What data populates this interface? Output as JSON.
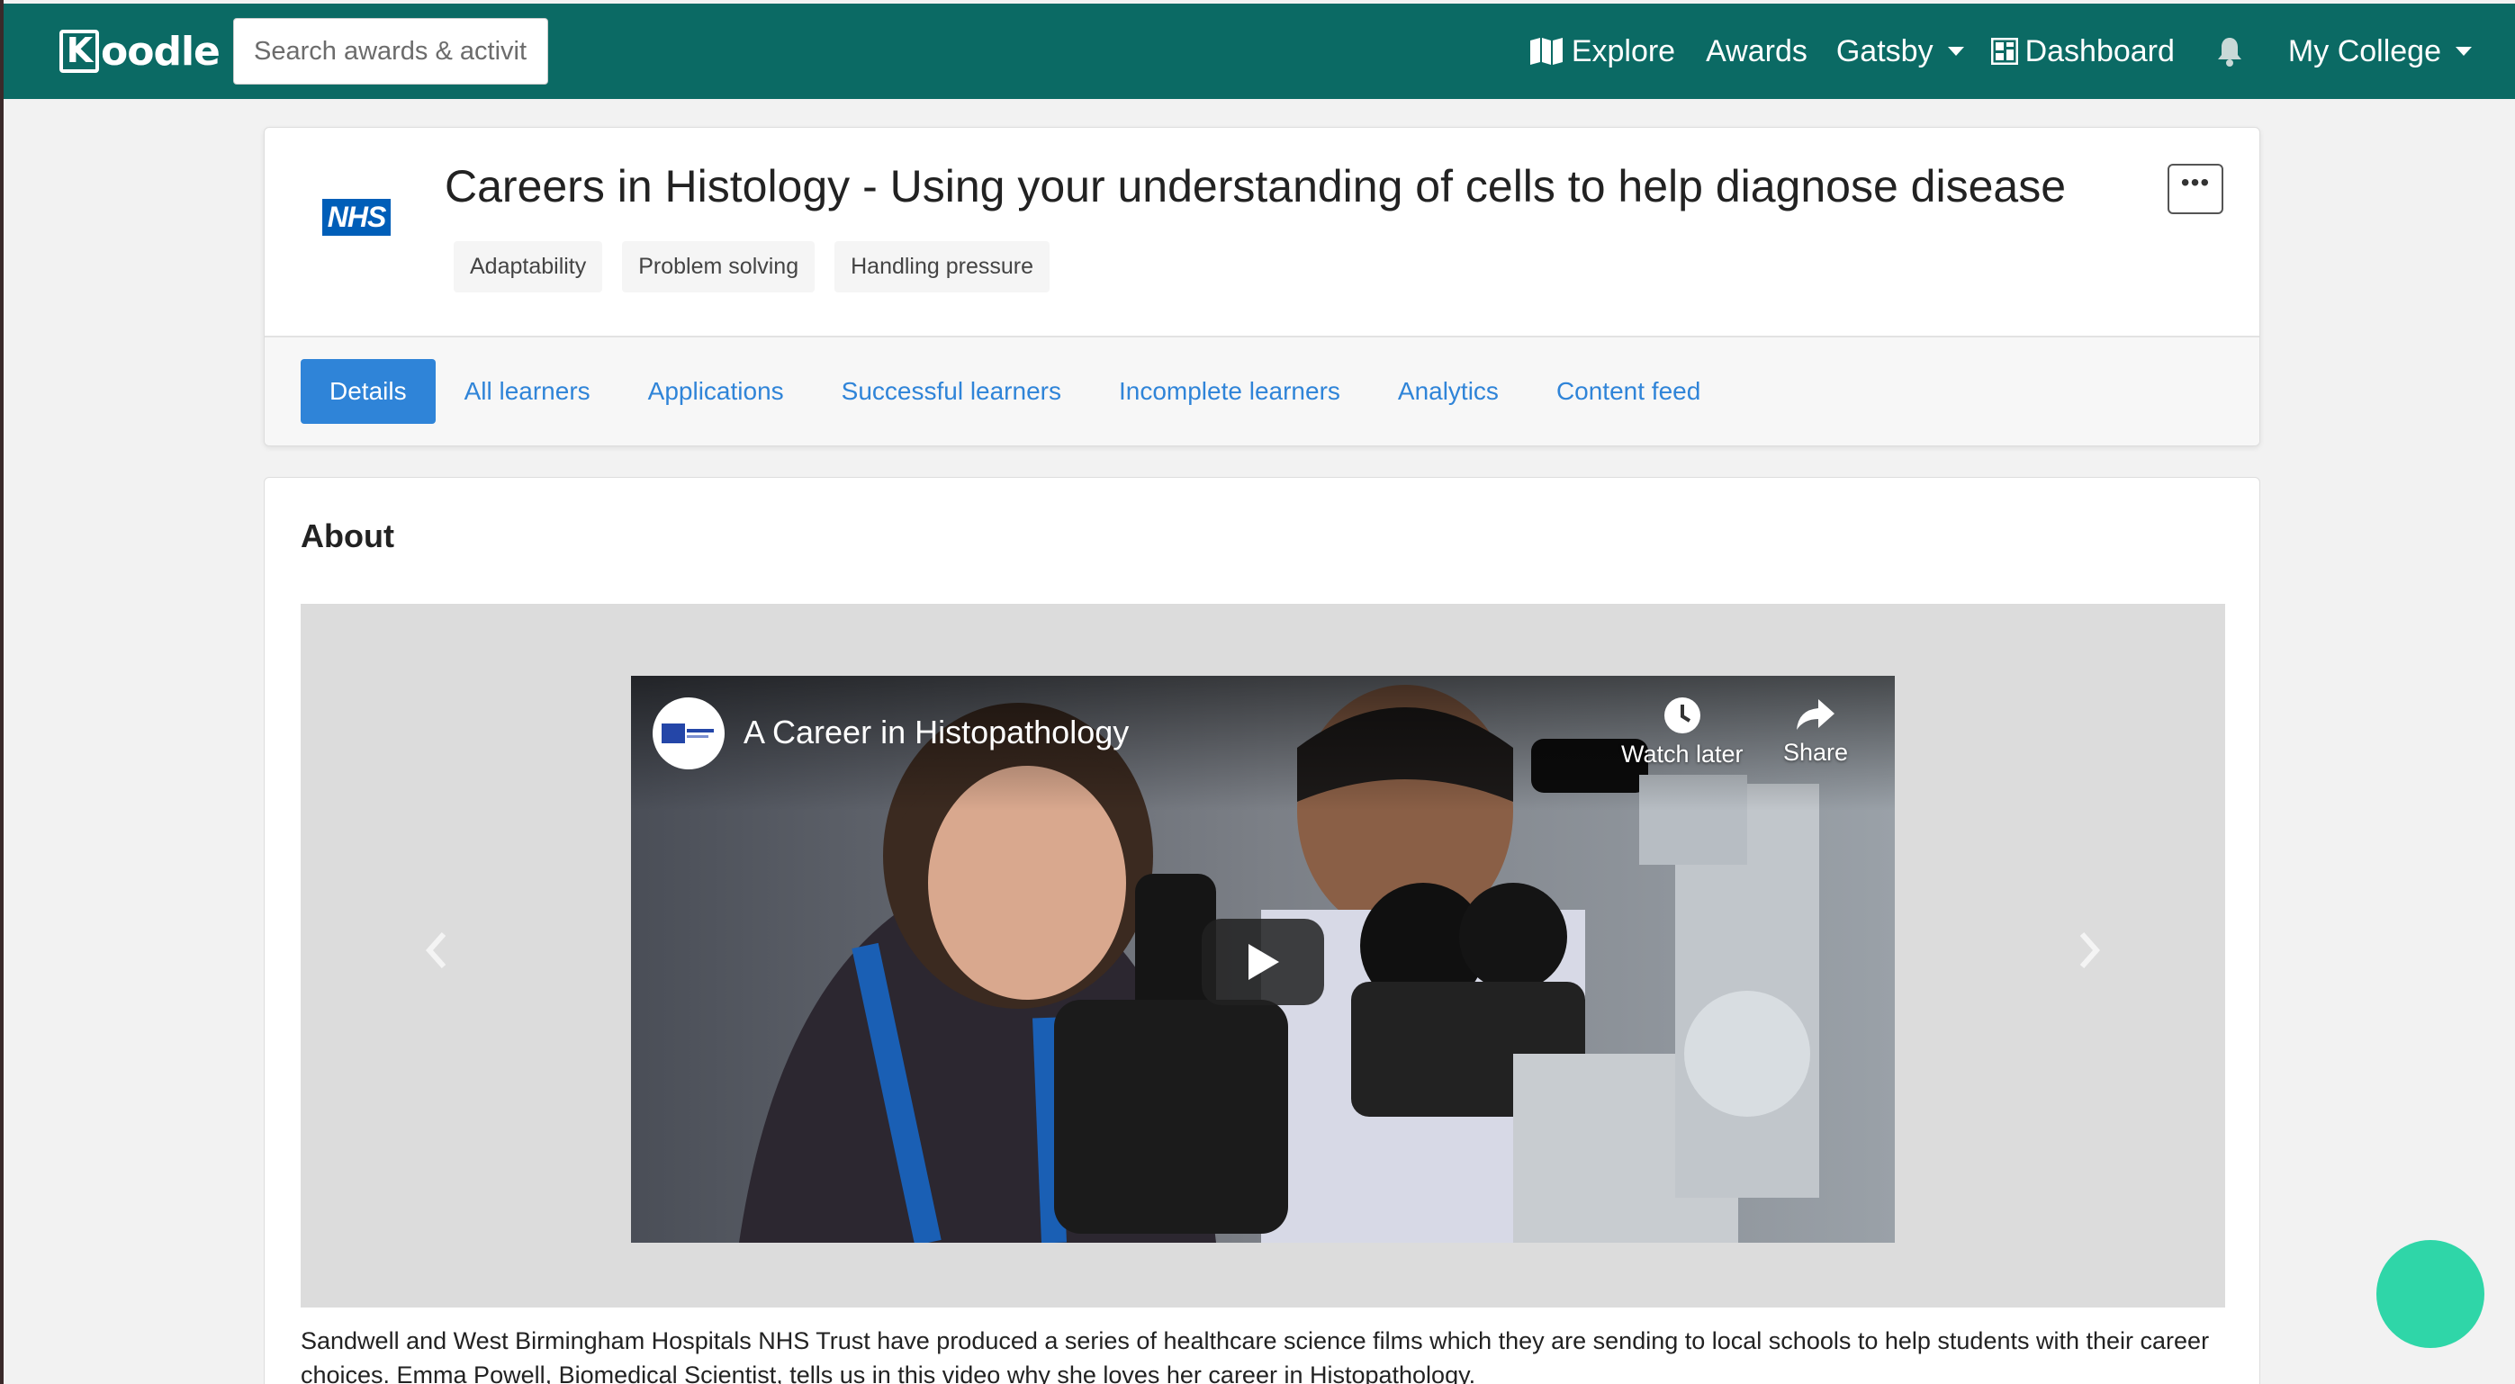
{
  "app": {
    "logo_k": "K",
    "logo_rest": "oodle"
  },
  "navbar": {
    "search_placeholder": "Search awards & activities",
    "explore": "Explore",
    "awards": "Awards",
    "gatsby": "Gatsby",
    "dashboard": "Dashboard",
    "my_college": "My College"
  },
  "activity": {
    "logo_text": "NHS",
    "title": "Careers in Histology - Using your understanding of cells to help diagnose disease",
    "tags": [
      "Adaptability",
      "Problem solving",
      "Handling pressure"
    ],
    "more_label": "•••"
  },
  "tabs": [
    "Details",
    "All learners",
    "Applications",
    "Successful learners",
    "Incomplete learners",
    "Analytics",
    "Content feed"
  ],
  "about": {
    "heading": "About",
    "video": {
      "title": "A Career in Histopathology",
      "watch_later": "Watch later",
      "share": "Share"
    },
    "description": "Sandwell and West Birmingham Hospitals NHS Trust have produced a series of healthcare science films which they are sending to local schools to help students with their career choices. Emma Powell, Biomedical Scientist, tells us in this video why she loves her career in Histopathology."
  },
  "colors": {
    "navbar": "#0b6a64",
    "link": "#2f84d8",
    "active_tab": "#2f84d8",
    "chat_fab": "#2fd6a8"
  }
}
